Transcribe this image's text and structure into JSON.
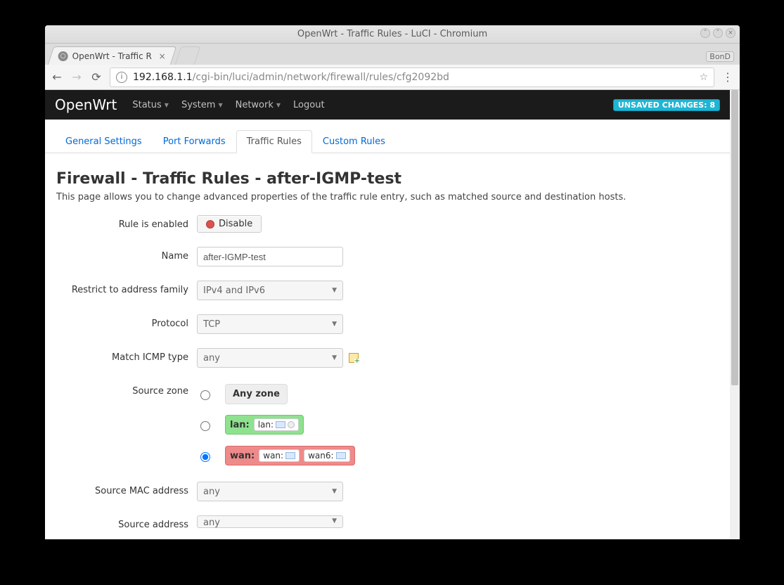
{
  "window": {
    "title": "OpenWrt - Traffic Rules - LuCI - Chromium",
    "distro_badge": "BonD"
  },
  "browser_tab": {
    "title": "OpenWrt - Traffic R"
  },
  "omnibox": {
    "host": "192.168.1.1",
    "path": "/cgi-bin/luci/admin/network/firewall/rules/cfg2092bd"
  },
  "luci": {
    "brand": "OpenWrt",
    "menu": [
      "Status",
      "System",
      "Network",
      "Logout"
    ],
    "unsaved": "UNSAVED CHANGES: 8",
    "tabs": [
      "General Settings",
      "Port Forwards",
      "Traffic Rules",
      "Custom Rules"
    ],
    "active_tab": 2
  },
  "page": {
    "title": "Firewall - Traffic Rules - after-IGMP-test",
    "description": "This page allows you to change advanced properties of the traffic rule entry, such as matched source and destination hosts."
  },
  "form": {
    "rule_enabled": {
      "label": "Rule is enabled",
      "button": "Disable"
    },
    "name": {
      "label": "Name",
      "value": "after-IGMP-test"
    },
    "family": {
      "label": "Restrict to address family",
      "value": "IPv4 and IPv6"
    },
    "protocol": {
      "label": "Protocol",
      "value": "TCP"
    },
    "icmp": {
      "label": "Match ICMP type",
      "value": "any"
    },
    "source_zone": {
      "label": "Source zone",
      "options": {
        "any": "Any zone",
        "lan_name": "lan:",
        "lan_ifaces": [
          "lan:"
        ],
        "wan_name": "wan:",
        "wan_ifaces": [
          "wan:",
          "wan6:"
        ]
      },
      "selected": "wan"
    },
    "src_mac": {
      "label": "Source MAC address",
      "value": "any"
    },
    "src_addr": {
      "label": "Source address",
      "value": "any"
    }
  }
}
